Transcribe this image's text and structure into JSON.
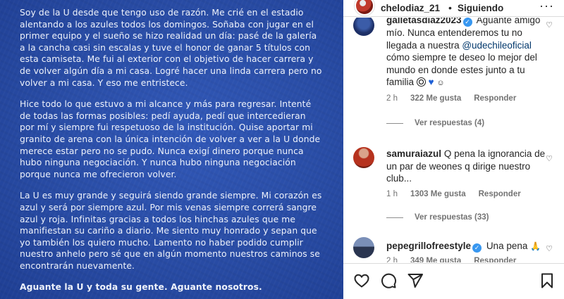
{
  "post": {
    "paragraphs": [
      "Soy de la U desde que tengo uso de razón. Me crié en el estadio alentando a los azules todos los domingos. Soñaba con jugar en el primer equipo y el sueño se hizo realidad un día: pasé de la galería a la cancha casi sin escalas y tuve el honor de ganar 5 títulos con esta camiseta. Me fui al exterior con el objetivo de hacer carrera y de volver algún día a mi casa. Logré hacer una linda carrera pero no volver a mi casa. Y eso me entristece.",
      "Hice todo lo que estuvo a mi alcance y más para regresar. Intenté de todas las formas posibles: pedí ayuda, pedí que intercedieran por mí y siempre fui respetuoso de la institución. Quise aportar mi granito de arena con la única intención de volver a ver a la U donde merece estar pero no se pudo. Nunca exigí dinero porque nunca hubo ninguna negociación. Y nunca hubo ninguna negociación porque nunca me ofrecieron volver.",
      "La U es muy grande y seguirá siendo grande siempre. Mi corazón es azul y será por siempre azul. Por mis venas siempre correrá sangre azul y roja. Infinitas gracias a todos los hinchas azules que me manifiestan su cariño a diario. Me siento muy honrado y sepan que yo también los quiero mucho. Lamento no haber podido cumplir nuestro anhelo pero sé que en algún momento nuestros caminos se encontrarán nuevamente."
    ],
    "closing": "Aguante la U y toda su gente. Aguante nosotros."
  },
  "header": {
    "username": "chelodiaz_21",
    "separator": "•",
    "follow_status": "Siguiendo",
    "more": "···"
  },
  "comments": [
    {
      "username": "galletasdiaz2023",
      "text_before": "Aguante amigo mío. Nunca entenderemos tu no llegada a nuestra ",
      "mention": "@udechileoficial",
      "text_after": " cómo siempre te deseo lo mejor del mundo en donde estes junto a tu familia ",
      "time": "2 h",
      "likes": "322 Me gusta",
      "reply": "Responder",
      "view_replies": "Ver respuestas (4)"
    },
    {
      "username": "samuraiazul",
      "text": "Q pena la ignorancia de un par de weones q dirige nuestro club...",
      "time": "1 h",
      "likes": "1303 Me gusta",
      "reply": "Responder",
      "view_replies": "Ver respuestas (33)"
    },
    {
      "username": "pepegrillofreestyle",
      "text": "Una pena",
      "time": "2 h",
      "likes": "349 Me gusta",
      "reply": "Responder"
    }
  ],
  "icons": {
    "like": "heart-icon",
    "comment": "comment-icon",
    "share": "send-icon",
    "save": "bookmark-icon"
  },
  "colors": {
    "post_background": "#2a4ea8",
    "verified": "#3897f0",
    "mention": "#00376b"
  }
}
